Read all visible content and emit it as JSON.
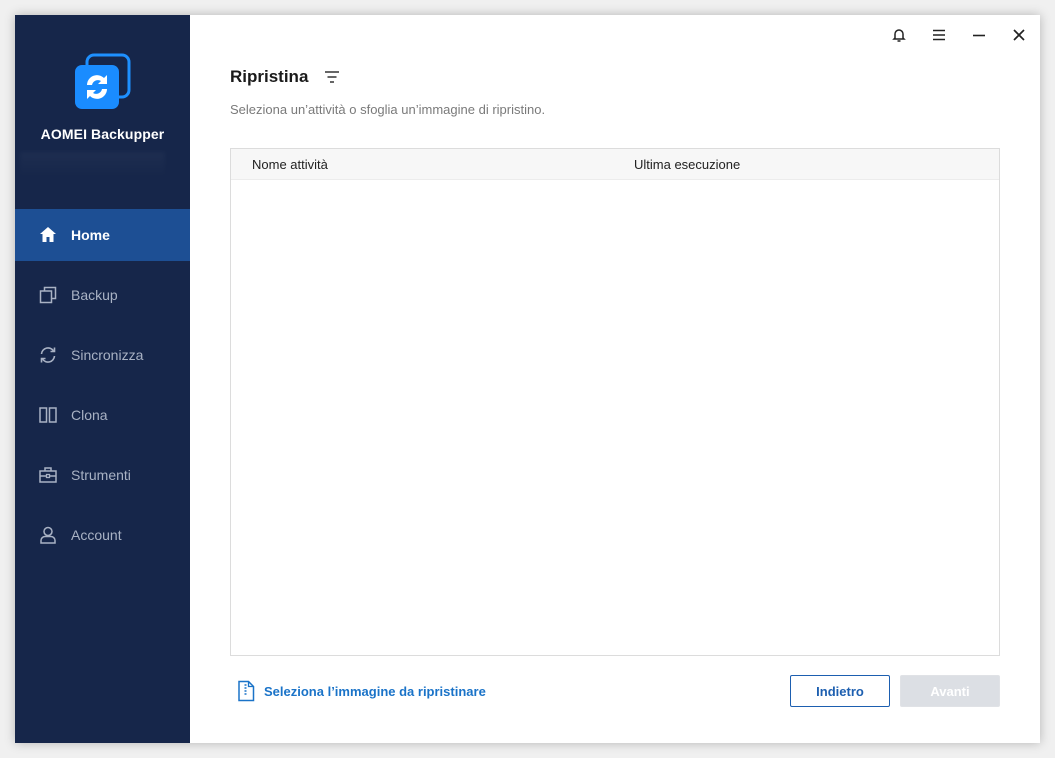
{
  "app": {
    "name": "AOMEI Backupper",
    "accent": "#1d4f94",
    "sidebar_bg": "#16264a",
    "link_color": "#1a73c8"
  },
  "sidebar": {
    "items": [
      {
        "label": "Home",
        "icon": "home-icon",
        "active": true
      },
      {
        "label": "Backup",
        "icon": "backup-icon",
        "active": false
      },
      {
        "label": "Sincronizza",
        "icon": "sync-icon",
        "active": false
      },
      {
        "label": "Clona",
        "icon": "clone-icon",
        "active": false
      },
      {
        "label": "Strumenti",
        "icon": "tools-icon",
        "active": false
      },
      {
        "label": "Account",
        "icon": "account-icon",
        "active": false
      }
    ]
  },
  "titlebar": {
    "icons": [
      "bell-icon",
      "menu-icon",
      "minimize-icon",
      "close-icon"
    ]
  },
  "main": {
    "title": "Ripristina",
    "subtitle": "Seleziona un’attività o sfoglia un’immagine di ripristino.",
    "table": {
      "columns": [
        "Nome attività",
        "Ultima esecuzione"
      ],
      "rows": []
    },
    "select_image_label": "Seleziona l’immagine da ripristinare",
    "back_label": "Indietro",
    "next_label": "Avanti"
  }
}
